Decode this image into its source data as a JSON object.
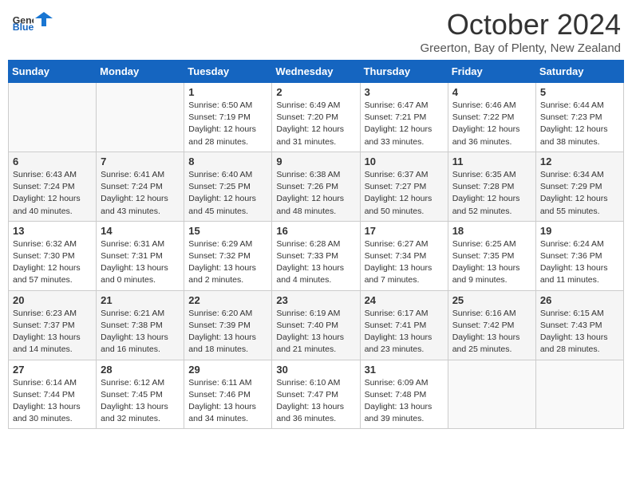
{
  "header": {
    "logo": {
      "general": "General",
      "blue": "Blue"
    },
    "title": "October 2024",
    "location": "Greerton, Bay of Plenty, New Zealand"
  },
  "calendar": {
    "days_of_week": [
      "Sunday",
      "Monday",
      "Tuesday",
      "Wednesday",
      "Thursday",
      "Friday",
      "Saturday"
    ],
    "weeks": [
      [
        {
          "day": "",
          "info": ""
        },
        {
          "day": "",
          "info": ""
        },
        {
          "day": "1",
          "info": "Sunrise: 6:50 AM\nSunset: 7:19 PM\nDaylight: 12 hours and 28 minutes."
        },
        {
          "day": "2",
          "info": "Sunrise: 6:49 AM\nSunset: 7:20 PM\nDaylight: 12 hours and 31 minutes."
        },
        {
          "day": "3",
          "info": "Sunrise: 6:47 AM\nSunset: 7:21 PM\nDaylight: 12 hours and 33 minutes."
        },
        {
          "day": "4",
          "info": "Sunrise: 6:46 AM\nSunset: 7:22 PM\nDaylight: 12 hours and 36 minutes."
        },
        {
          "day": "5",
          "info": "Sunrise: 6:44 AM\nSunset: 7:23 PM\nDaylight: 12 hours and 38 minutes."
        }
      ],
      [
        {
          "day": "6",
          "info": "Sunrise: 6:43 AM\nSunset: 7:24 PM\nDaylight: 12 hours and 40 minutes."
        },
        {
          "day": "7",
          "info": "Sunrise: 6:41 AM\nSunset: 7:24 PM\nDaylight: 12 hours and 43 minutes."
        },
        {
          "day": "8",
          "info": "Sunrise: 6:40 AM\nSunset: 7:25 PM\nDaylight: 12 hours and 45 minutes."
        },
        {
          "day": "9",
          "info": "Sunrise: 6:38 AM\nSunset: 7:26 PM\nDaylight: 12 hours and 48 minutes."
        },
        {
          "day": "10",
          "info": "Sunrise: 6:37 AM\nSunset: 7:27 PM\nDaylight: 12 hours and 50 minutes."
        },
        {
          "day": "11",
          "info": "Sunrise: 6:35 AM\nSunset: 7:28 PM\nDaylight: 12 hours and 52 minutes."
        },
        {
          "day": "12",
          "info": "Sunrise: 6:34 AM\nSunset: 7:29 PM\nDaylight: 12 hours and 55 minutes."
        }
      ],
      [
        {
          "day": "13",
          "info": "Sunrise: 6:32 AM\nSunset: 7:30 PM\nDaylight: 12 hours and 57 minutes."
        },
        {
          "day": "14",
          "info": "Sunrise: 6:31 AM\nSunset: 7:31 PM\nDaylight: 13 hours and 0 minutes."
        },
        {
          "day": "15",
          "info": "Sunrise: 6:29 AM\nSunset: 7:32 PM\nDaylight: 13 hours and 2 minutes."
        },
        {
          "day": "16",
          "info": "Sunrise: 6:28 AM\nSunset: 7:33 PM\nDaylight: 13 hours and 4 minutes."
        },
        {
          "day": "17",
          "info": "Sunrise: 6:27 AM\nSunset: 7:34 PM\nDaylight: 13 hours and 7 minutes."
        },
        {
          "day": "18",
          "info": "Sunrise: 6:25 AM\nSunset: 7:35 PM\nDaylight: 13 hours and 9 minutes."
        },
        {
          "day": "19",
          "info": "Sunrise: 6:24 AM\nSunset: 7:36 PM\nDaylight: 13 hours and 11 minutes."
        }
      ],
      [
        {
          "day": "20",
          "info": "Sunrise: 6:23 AM\nSunset: 7:37 PM\nDaylight: 13 hours and 14 minutes."
        },
        {
          "day": "21",
          "info": "Sunrise: 6:21 AM\nSunset: 7:38 PM\nDaylight: 13 hours and 16 minutes."
        },
        {
          "day": "22",
          "info": "Sunrise: 6:20 AM\nSunset: 7:39 PM\nDaylight: 13 hours and 18 minutes."
        },
        {
          "day": "23",
          "info": "Sunrise: 6:19 AM\nSunset: 7:40 PM\nDaylight: 13 hours and 21 minutes."
        },
        {
          "day": "24",
          "info": "Sunrise: 6:17 AM\nSunset: 7:41 PM\nDaylight: 13 hours and 23 minutes."
        },
        {
          "day": "25",
          "info": "Sunrise: 6:16 AM\nSunset: 7:42 PM\nDaylight: 13 hours and 25 minutes."
        },
        {
          "day": "26",
          "info": "Sunrise: 6:15 AM\nSunset: 7:43 PM\nDaylight: 13 hours and 28 minutes."
        }
      ],
      [
        {
          "day": "27",
          "info": "Sunrise: 6:14 AM\nSunset: 7:44 PM\nDaylight: 13 hours and 30 minutes."
        },
        {
          "day": "28",
          "info": "Sunrise: 6:12 AM\nSunset: 7:45 PM\nDaylight: 13 hours and 32 minutes."
        },
        {
          "day": "29",
          "info": "Sunrise: 6:11 AM\nSunset: 7:46 PM\nDaylight: 13 hours and 34 minutes."
        },
        {
          "day": "30",
          "info": "Sunrise: 6:10 AM\nSunset: 7:47 PM\nDaylight: 13 hours and 36 minutes."
        },
        {
          "day": "31",
          "info": "Sunrise: 6:09 AM\nSunset: 7:48 PM\nDaylight: 13 hours and 39 minutes."
        },
        {
          "day": "",
          "info": ""
        },
        {
          "day": "",
          "info": ""
        }
      ]
    ]
  }
}
